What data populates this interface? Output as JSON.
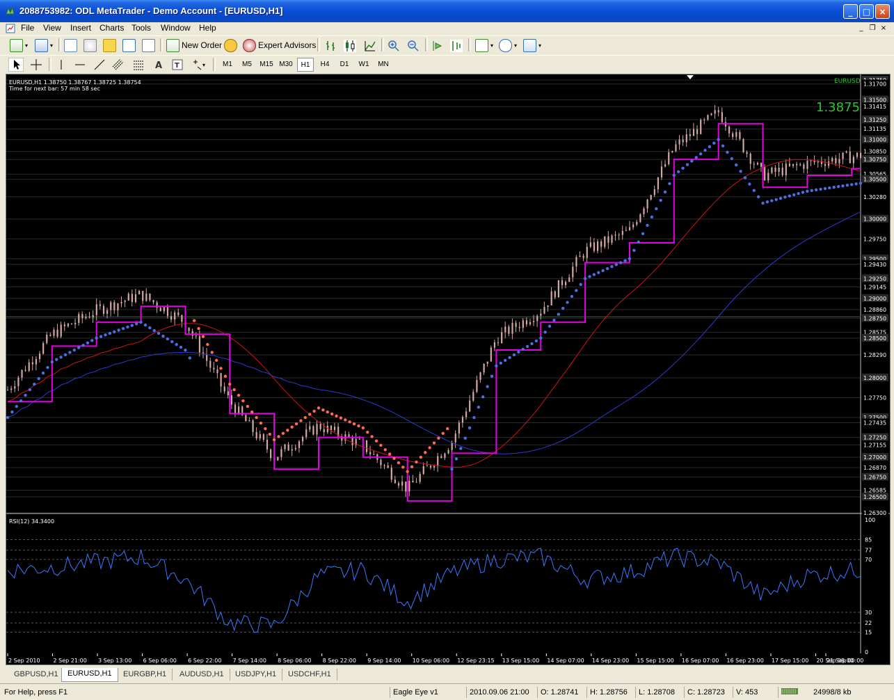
{
  "window": {
    "title": "2088753982: ODL MetaTrader - Demo Account - [EURUSD,H1]",
    "min_label": "_",
    "max_label": "□",
    "close_label": "×"
  },
  "menu": [
    "File",
    "View",
    "Insert",
    "Charts",
    "Tools",
    "Window",
    "Help"
  ],
  "toolbar": {
    "new_order": "New Order",
    "expert_advisors": "Expert Advisors"
  },
  "timeframes": [
    "M1",
    "M5",
    "M15",
    "M30",
    "H1",
    "H4",
    "D1",
    "W1",
    "MN"
  ],
  "active_timeframe": "H1",
  "chart": {
    "info_line": "EURUSD,H1  1.38750 1.38767 1.38725 1.38754",
    "next_bar": "Time for next bar: 57 min 58 sec",
    "symbol": "EURUSD",
    "big_price": "1.3875",
    "rsi_label": "RSI(12) 34.3400",
    "colors": {
      "background": "#000000",
      "candle": "#D2A9A3",
      "magenta": "#E600E6",
      "red_dots": "#FF6A50",
      "blue_dots": "#4A6FE3",
      "ma_red": "#D01414",
      "ma_blue": "#2A3CD0",
      "rsi_line": "#3C78FF",
      "price_green": "#2FC32F"
    }
  },
  "chart_data": [
    {
      "type": "line",
      "title": "EURUSD,H1",
      "price_axis_ticks": [
        "1.31750",
        "1.31700",
        "1.31500",
        "1.31415",
        "1.31250",
        "1.31135",
        "1.31000",
        "1.30850",
        "1.30750",
        "1.30565",
        "1.30500",
        "1.30280",
        "1.30000",
        "1.29750",
        "1.29500",
        "1.29430",
        "1.29250",
        "1.29145",
        "1.29000",
        "1.28860",
        "1.28750",
        "1.28575",
        "1.28500",
        "1.28290",
        "1.28000",
        "1.27750",
        "1.27500",
        "1.27435",
        "1.27250",
        "1.27155",
        "1.27000",
        "1.26870",
        "1.26750",
        "1.26585",
        "1.26500",
        "1.26300"
      ],
      "time_axis_ticks": [
        "2 Sep 2010",
        "2 Sep 21:00",
        "3 Sep 13:00",
        "6 Sep 06:00",
        "6 Sep 22:00",
        "7 Sep 14:00",
        "8 Sep 06:00",
        "8 Sep 22:00",
        "9 Sep 14:00",
        "10 Sep 06:00",
        "12 Sep 23:15",
        "13 Sep 15:00",
        "14 Sep 07:00",
        "14 Sep 23:00",
        "15 Sep 15:00",
        "16 Sep 07:00",
        "16 Sep 23:00",
        "17 Sep 15:00",
        "20 Sep 08:00",
        "21 Sep 00:00"
      ],
      "ylim": [
        1.263,
        1.3175
      ],
      "x_index_count": 385,
      "series": [
        {
          "name": "EURUSD close",
          "x": [
            0,
            20,
            40,
            60,
            80,
            100,
            120,
            140,
            160,
            180,
            200,
            220,
            240,
            260,
            280,
            300,
            320,
            340,
            360,
            384
          ],
          "values": [
            1.2785,
            1.2855,
            1.2885,
            1.2905,
            1.287,
            1.277,
            1.27,
            1.274,
            1.2715,
            1.266,
            1.272,
            1.285,
            1.2885,
            1.296,
            1.2985,
            1.309,
            1.3135,
            1.3055,
            1.307,
            1.308
          ]
        }
      ]
    },
    {
      "type": "line",
      "title": "RSI(12) 34.3400",
      "rsi_axis_ticks": [
        "100",
        "85",
        "77",
        "70",
        "30",
        "22",
        "15",
        "0"
      ],
      "ylim": [
        0,
        100
      ],
      "series": [
        {
          "name": "RSI(12)",
          "x": [
            0,
            20,
            40,
            60,
            80,
            100,
            120,
            140,
            160,
            180,
            200,
            220,
            240,
            260,
            280,
            300,
            320,
            340,
            360,
            384
          ],
          "values": [
            62,
            64,
            68,
            72,
            55,
            22,
            20,
            58,
            62,
            38,
            60,
            70,
            72,
            55,
            60,
            72,
            68,
            42,
            58,
            62
          ]
        }
      ]
    }
  ],
  "tabs": [
    "GBPUSD,H1",
    "EURUSD,H1",
    "EURGBP,H1",
    "AUDUSD,H1",
    "USDJPY,H1",
    "USDCHF,H1"
  ],
  "active_tab": "EURUSD,H1",
  "status": {
    "help": "For Help, press F1",
    "profile": "Eagle Eye v1",
    "datetime": "2010.09.06 21:00",
    "open": "O: 1.28741",
    "high": "H: 1.28756",
    "low": "L: 1.28708",
    "close": "C: 1.28723",
    "volume": "V: 453",
    "traffic": "24998/8 kb"
  }
}
